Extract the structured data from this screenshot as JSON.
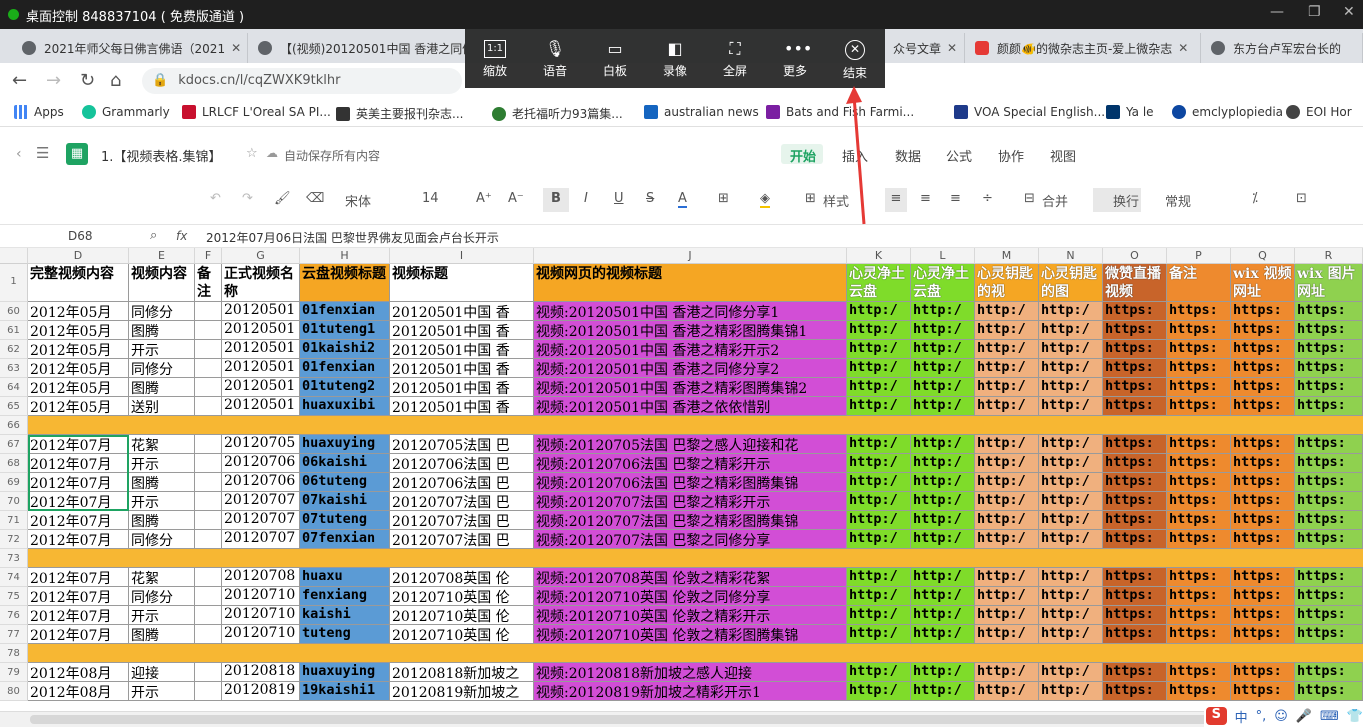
{
  "window": {
    "title": "桌面控制 848837104 ( 免费版通道 )"
  },
  "tabs": [
    {
      "label": "2021年师父每日佛言佛语（2021",
      "active": false
    },
    {
      "label": "【(视频)20120501中国 香港之同修",
      "active": false
    },
    {
      "label": "众号文章",
      "active": false
    },
    {
      "label": "颜颜🐠的微杂志主页-爱上微杂志",
      "active": false
    },
    {
      "label": "东方台卢军宏台长的",
      "active": false
    }
  ],
  "address": {
    "url": "kdocs.cn/l/cqZWXK9tklhr"
  },
  "bookmarks": [
    {
      "label": "Apps",
      "icon": "apps-grid-icon",
      "color": "#4285f4"
    },
    {
      "label": "Grammarly",
      "icon": "grammarly-icon",
      "color": "#15c39a"
    },
    {
      "label": "LRLCF L'Oreal SA PI...",
      "icon": "loreal-icon",
      "color": "#c8102e"
    },
    {
      "label": "英美主要报刊杂志...",
      "icon": "en-icon",
      "color": "#333333"
    },
    {
      "label": "老托福听力93篇集...",
      "icon": "leaf-icon",
      "color": "#2e7d32"
    },
    {
      "label": "australian news",
      "icon": "hs-icon",
      "color": "#1565c0"
    },
    {
      "label": "Bats and Fish Farmi...",
      "icon": "mt-icon",
      "color": "#1e3a8a"
    },
    {
      "label": "VOA Special English...",
      "icon": "mt-icon",
      "color": "#1e3a8a"
    },
    {
      "label": "Ya le",
      "icon": "yale-icon",
      "color": "#00356b"
    },
    {
      "label": "emclyplopiedia",
      "icon": "globe-icon",
      "color": "#0d47a1"
    },
    {
      "label": "EOI Hor",
      "icon": "globe-icon",
      "color": "#444444"
    }
  ],
  "app": {
    "doc_title": "1.【视频表格.集锦】",
    "autosave": "自动保存所有内容",
    "menus": [
      "开始",
      "插入",
      "数据",
      "公式",
      "协作",
      "视图"
    ],
    "active_menu": "开始"
  },
  "toolbar": {
    "font": "宋体",
    "size": "14",
    "style_label": "样式",
    "merge_label": "合并",
    "wrap_label": "换行",
    "format_label": "常规"
  },
  "formula": {
    "cell_ref": "D68",
    "fx": "fx",
    "content": "2012年07月06日法国 巴黎世界佛友见面会卢台长开示"
  },
  "overlay": {
    "buttons": [
      {
        "label": "缩放",
        "icon": "zoom-1to1-icon"
      },
      {
        "label": "语音",
        "icon": "microphone-icon"
      },
      {
        "label": "白板",
        "icon": "whiteboard-icon"
      },
      {
        "label": "录像",
        "icon": "video-camera-icon"
      },
      {
        "label": "全屏",
        "icon": "fullscreen-icon"
      },
      {
        "label": "更多",
        "icon": "more-dots-icon"
      },
      {
        "label": "结束",
        "icon": "end-circle-x-icon"
      }
    ]
  },
  "colors": {
    "orange": "#f5a623",
    "blue": "#5b9bd5",
    "magenta": "#d24ed6",
    "green": "#7fdc2a",
    "salmon": "#f0b07e",
    "brown": "#c8642a",
    "darkorange": "#ee8a2e",
    "lightgreen": "#8fd14f",
    "separator": "#f7b733"
  },
  "sheet": {
    "columns": [
      "D",
      "E",
      "F",
      "G",
      "H",
      "I",
      "J",
      "K",
      "L",
      "M",
      "N",
      "O",
      "P",
      "Q",
      "R"
    ],
    "header_row": {
      "n": "1",
      "cells": [
        "完整视频内容",
        "视频内容",
        "备注",
        "正式视频名称",
        "云盘视频标题",
        "视频标题",
        "视频网页的视频标题",
        "心灵净土云盘",
        "心灵净土云盘",
        "心灵钥匙的视",
        "心灵钥匙的图",
        "微赞直播 视频",
        "备注",
        "wix 视频 网址",
        "wix 图片网址"
      ]
    },
    "rows": [
      {
        "n": "60",
        "D": "2012年05月",
        "E": "同修分",
        "G": "20120501",
        "H": "01fenxian",
        "I": "20120501中国 香",
        "J": "视频:20120501中国 香港之同修分享1"
      },
      {
        "n": "61",
        "D": "2012年05月",
        "E": "图腾",
        "G": "20120501",
        "H": "01tuteng1",
        "I": "20120501中国 香",
        "J": "视频:20120501中国 香港之精彩图腾集锦1"
      },
      {
        "n": "62",
        "D": "2012年05月",
        "E": "开示",
        "G": "20120501",
        "H": "01kaishi2",
        "I": "20120501中国 香",
        "J": "视频:20120501中国 香港之精彩开示2"
      },
      {
        "n": "63",
        "D": "2012年05月",
        "E": "同修分",
        "G": "20120501",
        "H": "01fenxian",
        "I": "20120501中国 香",
        "J": "视频:20120501中国 香港之同修分享2"
      },
      {
        "n": "64",
        "D": "2012年05月",
        "E": "图腾",
        "G": "20120501",
        "H": "01tuteng2",
        "I": "20120501中国 香",
        "J": "视频:20120501中国 香港之精彩图腾集锦2"
      },
      {
        "n": "65",
        "D": "2012年05月",
        "E": "送别",
        "G": "20120501",
        "H": "huaxuxibi",
        "I": "20120501中国 香",
        "J": "视频:20120501中国 香港之依依惜别"
      },
      {
        "n": "66",
        "sep": true
      },
      {
        "n": "67",
        "D": "2012年07月",
        "E": "花絮",
        "G": "20120705",
        "H": "huaxuying",
        "I": "20120705法国 巴",
        "J": "视频:20120705法国 巴黎之感人迎接和花"
      },
      {
        "n": "68",
        "D": "2012年07月",
        "E": "开示",
        "G": "20120706",
        "H": "06kaishi",
        "I": "20120706法国 巴",
        "J": "视频:20120706法国 巴黎之精彩开示"
      },
      {
        "n": "69",
        "D": "2012年07月",
        "E": "图腾",
        "G": "20120706",
        "H": "06tuteng",
        "I": "20120706法国 巴",
        "J": "视频:20120706法国 巴黎之精彩图腾集锦"
      },
      {
        "n": "70",
        "D": "2012年07月",
        "E": "开示",
        "G": "20120707",
        "H": "07kaishi",
        "I": "20120707法国 巴",
        "J": "视频:20120707法国 巴黎之精彩开示"
      },
      {
        "n": "71",
        "D": "2012年07月",
        "E": "图腾",
        "G": "20120707",
        "H": "07tuteng",
        "I": "20120707法国 巴",
        "J": "视频:20120707法国 巴黎之精彩图腾集锦"
      },
      {
        "n": "72",
        "D": "2012年07月",
        "E": "同修分",
        "G": "20120707",
        "H": "07fenxian",
        "I": "20120707法国 巴",
        "J": "视频:20120707法国 巴黎之同修分享"
      },
      {
        "n": "73",
        "sep": true
      },
      {
        "n": "74",
        "D": "2012年07月",
        "E": "花絮",
        "G": "20120708",
        "H": "huaxu",
        "I": "20120708英国 伦",
        "J": "视频:20120708英国 伦敦之精彩花絮"
      },
      {
        "n": "75",
        "D": "2012年07月",
        "E": "同修分",
        "G": "20120710",
        "H": "fenxiang",
        "I": "20120710英国 伦",
        "J": "视频:20120710英国 伦敦之同修分享"
      },
      {
        "n": "76",
        "D": "2012年07月",
        "E": "开示",
        "G": "20120710",
        "H": "kaishi",
        "I": "20120710英国 伦",
        "J": "视频:20120710英国 伦敦之精彩开示"
      },
      {
        "n": "77",
        "D": "2012年07月",
        "E": "图腾",
        "G": "20120710",
        "H": "tuteng",
        "I": "20120710英国 伦",
        "J": "视频:20120710英国 伦敦之精彩图腾集锦"
      },
      {
        "n": "78",
        "sep": true
      },
      {
        "n": "79",
        "D": "2012年08月",
        "E": "迎接",
        "G": "20120818",
        "H": "huaxuying",
        "I": "20120818新加坡之",
        "J": "视频:20120818新加坡之感人迎接"
      },
      {
        "n": "80",
        "D": "2012年08月",
        "E": "开示",
        "G": "20120819",
        "H": "19kaishi1",
        "I": "20120819新加坡之",
        "J": "视频:20120819新加坡之精彩开示1"
      }
    ],
    "link_http": "http:/",
    "link_https": "https:"
  }
}
